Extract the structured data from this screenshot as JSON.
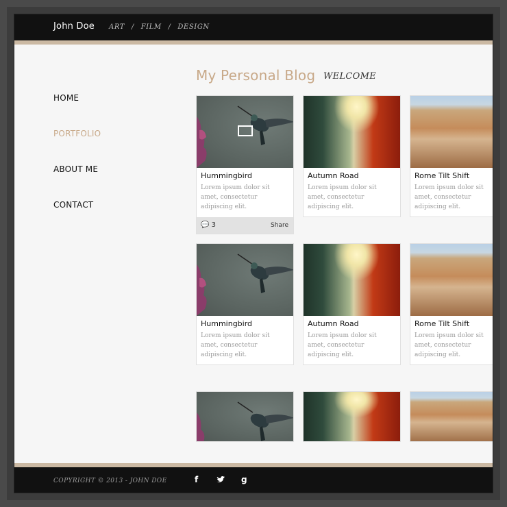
{
  "header": {
    "brand": "John Doe",
    "nav": [
      "ART",
      "FILM",
      "DESIGN"
    ],
    "separator": "/"
  },
  "sidebar": {
    "items": [
      {
        "label": "HOME",
        "active": false
      },
      {
        "label": "PORTFOLIO",
        "active": true
      },
      {
        "label": "ABOUT ME",
        "active": false
      },
      {
        "label": "CONTACT",
        "active": false
      }
    ]
  },
  "main": {
    "title": "My Personal Blog",
    "welcome": "WELCOME"
  },
  "cards": [
    {
      "title": "Hummingbird",
      "desc": "Lorem ipsum dolor sit amet, consectetur adipiscing elit.",
      "image": "hummingbird",
      "comments": "3",
      "share": "Share"
    },
    {
      "title": "Autumn Road",
      "desc": "Lorem ipsum dolor sit amet, consectetur adipiscing elit.",
      "image": "autumn-road"
    },
    {
      "title": "Rome Tilt Shift",
      "desc": "Lorem ipsum dolor sit amet, consectetur adipiscing elit.",
      "image": "rome-tilt-shift"
    },
    {
      "title": "Hummingbird",
      "desc": "Lorem ipsum dolor sit amet, consectetur adipiscing elit.",
      "image": "hummingbird"
    },
    {
      "title": "Autumn Road",
      "desc": "Lorem ipsum dolor sit amet, consectetur adipiscing elit.",
      "image": "autumn-road"
    },
    {
      "title": "Rome Tilt Shift",
      "desc": "Lorem ipsum dolor sit amet, consectetur adipiscing elit.",
      "image": "rome-tilt-shift"
    }
  ],
  "footer": {
    "copyright": "COPYRIGHT ©  2013 - JOHN DOE",
    "social": [
      {
        "icon": "facebook-icon",
        "glyph": "f"
      },
      {
        "icon": "twitter-icon",
        "glyph": "🐦"
      },
      {
        "icon": "google-icon",
        "glyph": "g"
      }
    ]
  },
  "colors": {
    "accent": "#c8a989",
    "header_bg": "#111111",
    "band": "#cbb9a3"
  }
}
